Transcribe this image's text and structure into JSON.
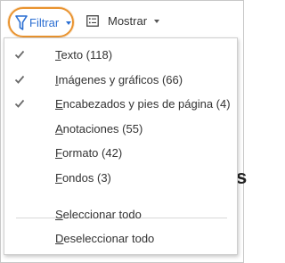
{
  "toolbar": {
    "filter_label": "Filtrar",
    "show_label": "Mostrar",
    "filter_icon": "funnel-icon",
    "show_icon": "list-view-icon",
    "accent_color": "#2a6ed2",
    "highlight_color": "#e9932f"
  },
  "menu": {
    "items": [
      {
        "label": "Texto (118)",
        "mnemonic": "T",
        "rest": "exto (118)",
        "checked": true
      },
      {
        "label": "Imágenes y gráficos (66)",
        "mnemonic": "I",
        "rest": "mágenes y gráficos (66)",
        "checked": true
      },
      {
        "label": "Encabezados y pies de página (4)",
        "mnemonic": "E",
        "rest": "ncabezados y pies de página (4)",
        "checked": true
      },
      {
        "label": "Anotaciones (55)",
        "mnemonic": "A",
        "rest": "notaciones (55)",
        "checked": false
      },
      {
        "label": "Formato (42)",
        "mnemonic": "F",
        "rest": "ormato (42)",
        "checked": false
      },
      {
        "label": "Fondos (3)",
        "mnemonic": "F",
        "rest": "ondos (3)",
        "checked": false
      }
    ],
    "actions": [
      {
        "label": "Seleccionar todo",
        "mnemonic": "S",
        "rest": "eleccionar todo"
      },
      {
        "label": "Deseleccionar todo",
        "mnemonic": "D",
        "rest": "eseleccionar todo"
      }
    ]
  },
  "background": {
    "partial_text": "s"
  }
}
